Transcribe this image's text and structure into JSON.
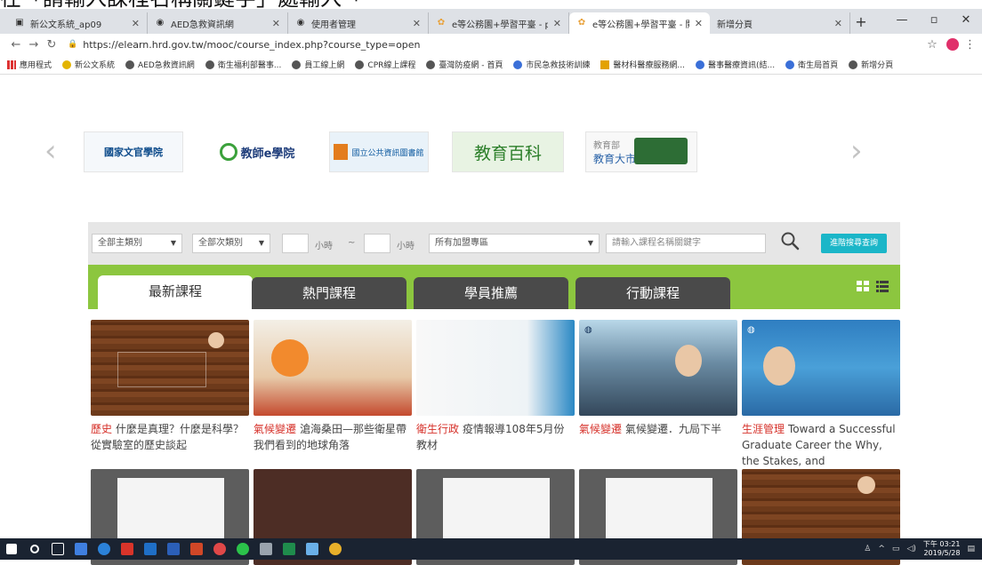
{
  "overlay_text": "在「請輸入課程名稱關鍵字」處輸入「",
  "browser": {
    "tabs": [
      {
        "title": "新公文系統_ap09",
        "active": false
      },
      {
        "title": "AED急救資訊網",
        "active": false
      },
      {
        "title": "使用者管理",
        "active": false
      },
      {
        "title": "e等公務園+學習平臺 - perso",
        "active": false
      },
      {
        "title": "e等公務園+學習平臺 - 開放式",
        "active": true
      },
      {
        "title": "新增分頁",
        "active": false
      }
    ],
    "new_tab": "+",
    "url": "https://elearn.hrd.gov.tw/mooc/course_index.php?course_type=open",
    "bookmarks": [
      "應用程式",
      "新公文系統",
      "AED急救資訊網",
      "衛生福利部醫事...",
      "員工線上網",
      "CPR線上課程",
      "臺灣防疫網 - 首頁",
      "市民急救技術訓練",
      "醫材科醫療服務網...",
      "醫事醫療資訊(結...",
      "衛生局首頁",
      "新增分頁"
    ]
  },
  "carousel": {
    "logos": [
      {
        "name": "國家文官學院"
      },
      {
        "name": "教師e學院"
      },
      {
        "name": "國立公共資訊圖書館"
      },
      {
        "name": "教育百科"
      },
      {
        "name": "教育大市集",
        "sub": "教育部"
      }
    ]
  },
  "filters": {
    "main_category": "全部主類別",
    "sub_category": "全部次類別",
    "hours_label": "小時",
    "hours_sep": "~",
    "hours_label2": "小時",
    "zone": "所有加盟專區",
    "keyword_placeholder": "請輸入課程名稱關鍵字",
    "advanced_search": "進階搜尋查詢"
  },
  "course_tabs": [
    {
      "label": "最新課程",
      "active": true
    },
    {
      "label": "熱門課程",
      "active": false
    },
    {
      "label": "學員推薦",
      "active": false
    },
    {
      "label": "行動課程",
      "active": false
    }
  ],
  "courses": [
    {
      "category": "歷史",
      "title": "什麼是真理？什麼是科學？從實驗室的歷史談起"
    },
    {
      "category": "氣候變遷",
      "title": "滄海桑田—那些衛星帶我們看到的地球角落"
    },
    {
      "category": "衛生行政",
      "title": "疫情報導108年5月份教材"
    },
    {
      "category": "氣候變遷",
      "title": "氣候變遷．九局下半"
    },
    {
      "category": "生涯管理",
      "title": "Toward a Successful Graduate Career the Why, the Stakes, and"
    }
  ],
  "taskbar": {
    "time": "下午 03:21",
    "date": "2019/5/28"
  }
}
